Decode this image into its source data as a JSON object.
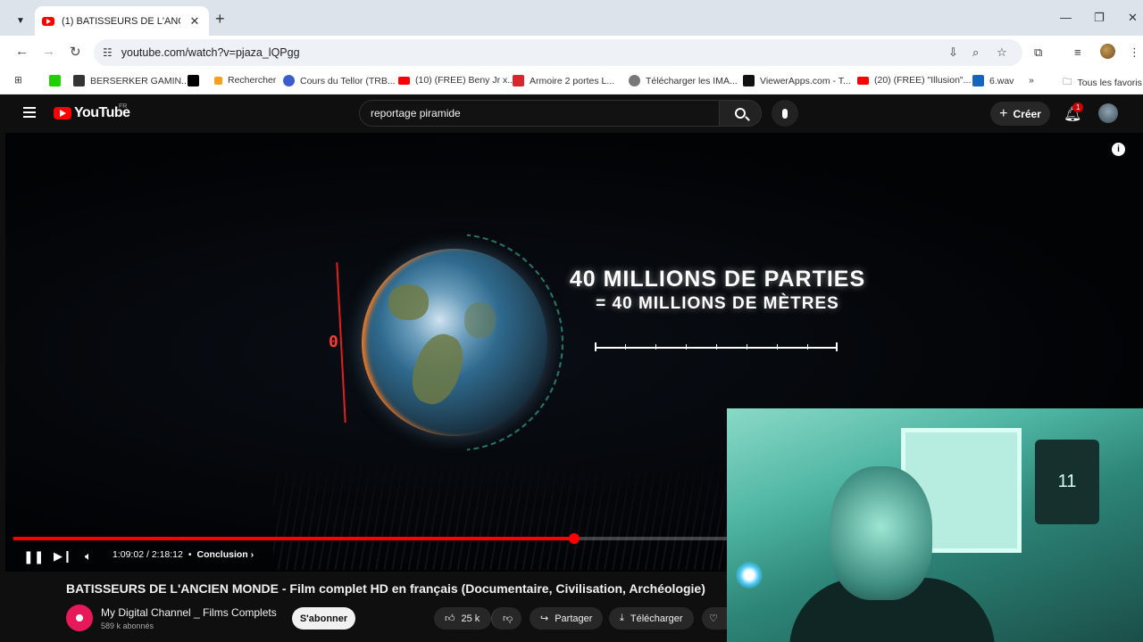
{
  "browser": {
    "tab_title": "(1) BATISSEURS DE L'ANCIEN M",
    "url": "youtube.com/watch?v=pjaza_lQPgg",
    "bookmarks": [
      {
        "label": "",
        "color": "#1fd000"
      },
      {
        "label": "BERSERKER GAMIN...",
        "color": "#333333"
      },
      {
        "label": "",
        "color": "#000000"
      },
      {
        "label": "Rechercher",
        "color": "#f7a01d"
      },
      {
        "label": "Cours du Tellor (TRB...",
        "color": "#3b5ccc"
      },
      {
        "label": "(10) (FREE) Beny Jr x...",
        "color": "#ff0000"
      },
      {
        "label": "Armoire 2 portes L...",
        "color": "#d7262e"
      },
      {
        "label": "Télécharger les IMA...",
        "color": "#555555"
      },
      {
        "label": "ViewerApps.com - T...",
        "color": "#111111"
      },
      {
        "label": "(20) (FREE) \"Illusion\"...",
        "color": "#ff0000"
      },
      {
        "label": "6.wav",
        "color": "#1565c0"
      }
    ],
    "all_bookmarks_label": "Tous les favoris"
  },
  "youtube": {
    "logo_text": "YouTube",
    "region": "FR",
    "search_query": "reportage piramide",
    "create_label": "Créer",
    "notification_count": "1"
  },
  "video": {
    "overlay_title": "40 MILLIONS DE PARTIES",
    "overlay_subtitle": "= 40 MILLIONS DE MÈTRES",
    "meridian_label": "0",
    "current_time": "1:09:02",
    "duration": "2:18:12",
    "chapter": "Conclusion",
    "progress_percent": 50.2
  },
  "details": {
    "title": "BATISSEURS DE L'ANCIEN MONDE - Film complet HD en français (Documentaire, Civilisation, Archéologie)",
    "channel_name": "My Digital Channel _ Films Complets",
    "subscribers": "589 k abonnés",
    "subscribe_label": "S'abonner",
    "likes": "25 k",
    "share_label": "Partager",
    "download_label": "Télécharger"
  },
  "webcam": {
    "jersey_number": "11"
  },
  "colors": {
    "accent": "#ff0000",
    "background": "#0f0f0f"
  }
}
